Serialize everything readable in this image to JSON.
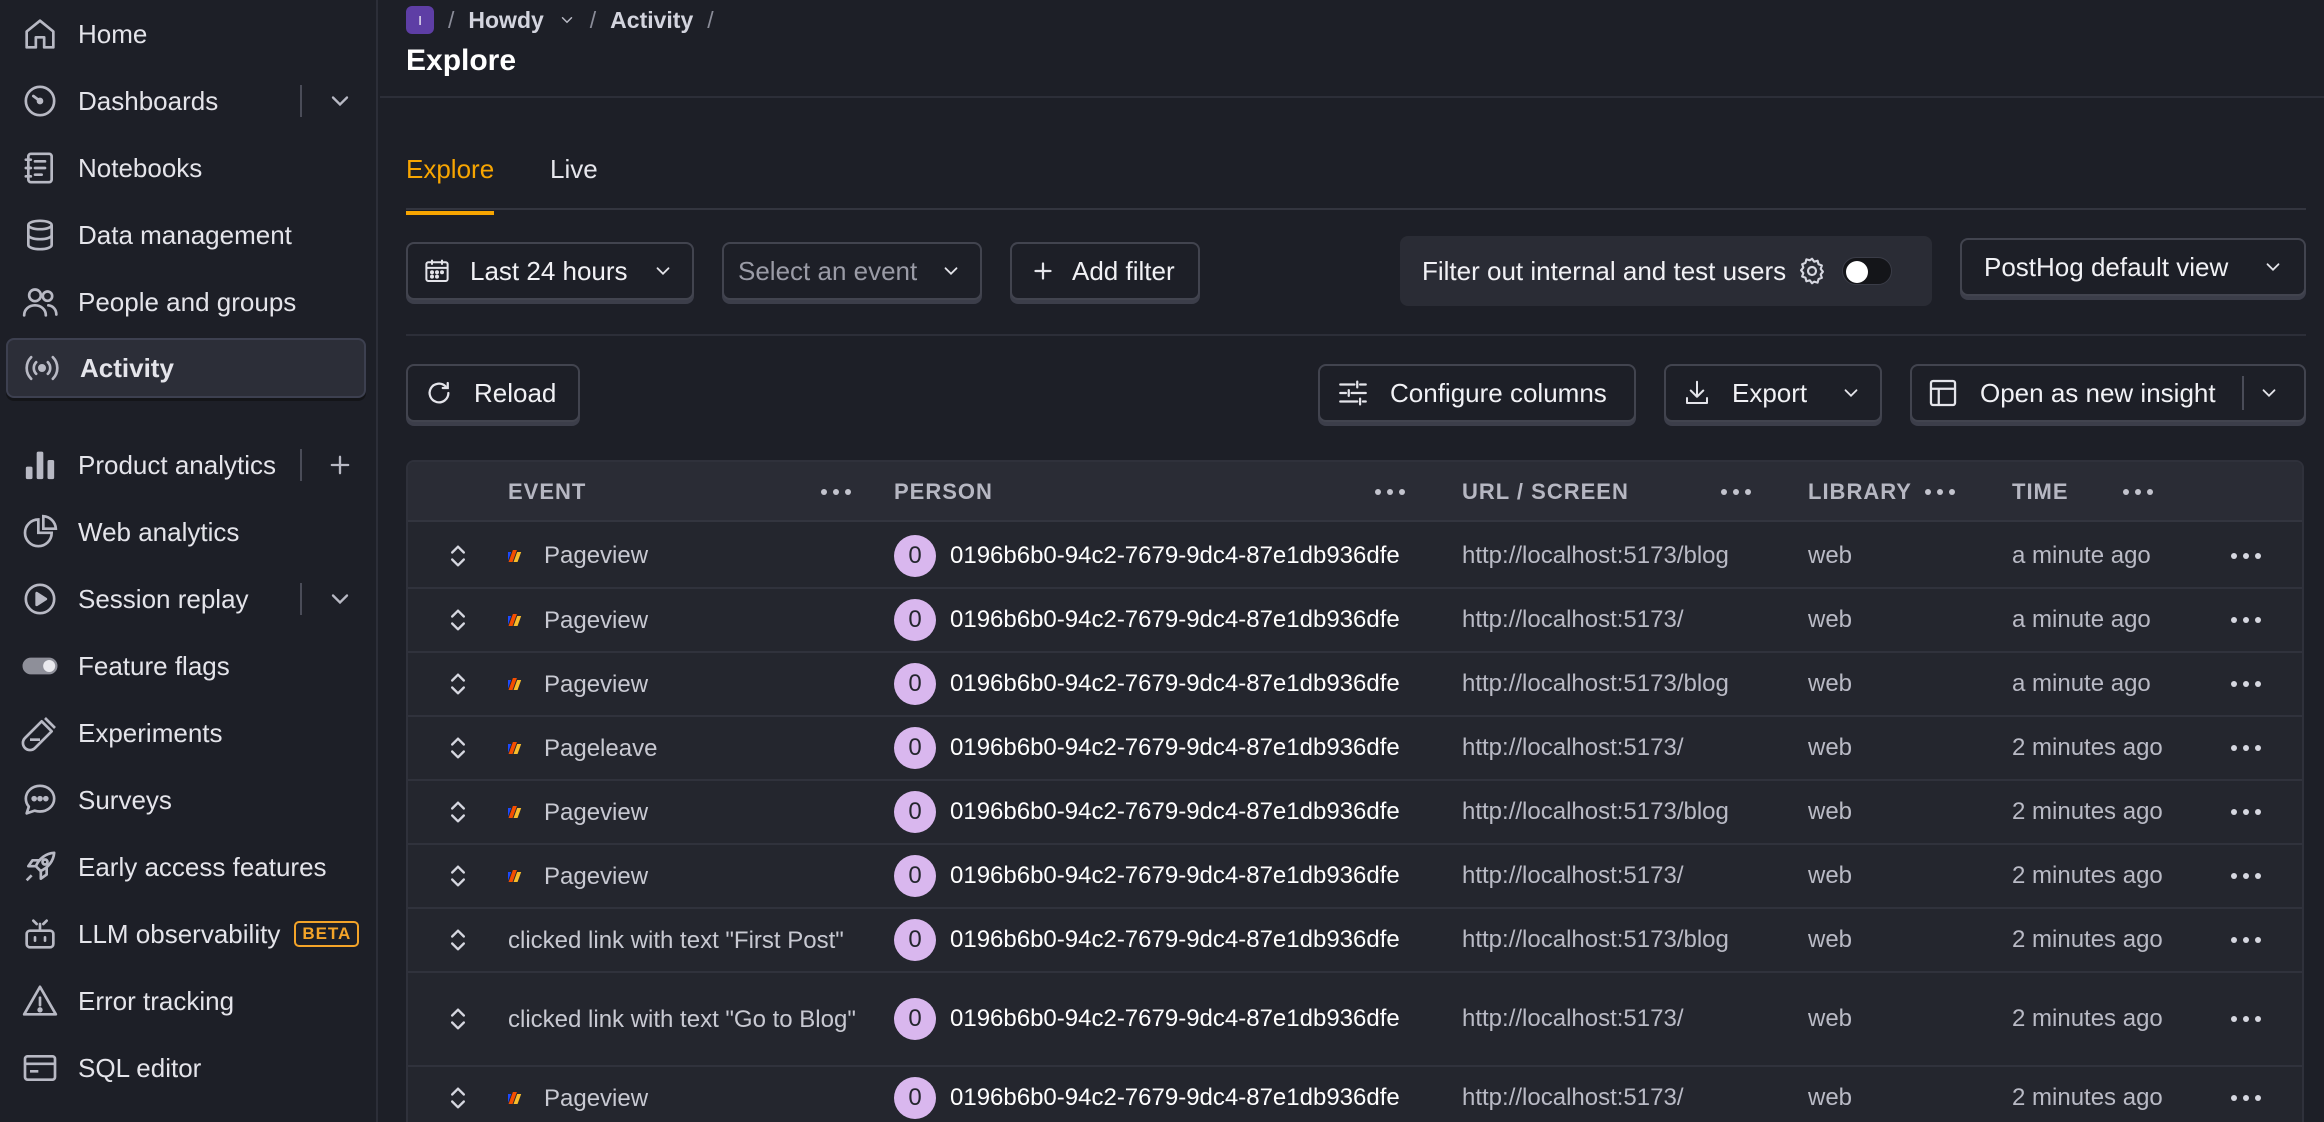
{
  "sidebar": {
    "items": [
      {
        "label": "Home",
        "icon": "home-icon"
      },
      {
        "label": "Dashboards",
        "icon": "dashboard-gauge-icon"
      },
      {
        "label": "Notebooks",
        "icon": "notebook-icon"
      },
      {
        "label": "Data management",
        "icon": "database-icon"
      },
      {
        "label": "People and groups",
        "icon": "people-icon"
      },
      {
        "label": "Activity",
        "icon": "broadcast-icon"
      },
      {
        "label": "Product analytics",
        "icon": "bar-chart-icon"
      },
      {
        "label": "Web analytics",
        "icon": "pie-chart-icon"
      },
      {
        "label": "Session replay",
        "icon": "replay-icon"
      },
      {
        "label": "Feature flags",
        "icon": "toggle-icon"
      },
      {
        "label": "Experiments",
        "icon": "flask-icon"
      },
      {
        "label": "Surveys",
        "icon": "chat-bubble-icon"
      },
      {
        "label": "Early access features",
        "icon": "rocket-icon"
      },
      {
        "label": "LLM observability",
        "icon": "llm-icon",
        "badge": "BETA"
      },
      {
        "label": "Error tracking",
        "icon": "warning-icon"
      },
      {
        "label": "SQL editor",
        "icon": "sql-editor-icon"
      }
    ]
  },
  "breadcrumb": {
    "project_badge": "I",
    "project": "Howdy",
    "section": "Activity"
  },
  "page": {
    "title": "Explore"
  },
  "tabs": [
    {
      "label": "Explore"
    },
    {
      "label": "Live"
    }
  ],
  "toolbar": {
    "date_range": "Last 24 hours",
    "event_placeholder": "Select an event",
    "add_filter": "Add filter",
    "filter_internal": "Filter out internal and test users",
    "view": "PostHog default view",
    "reload": "Reload",
    "configure_columns": "Configure columns",
    "export": "Export",
    "open_insight": "Open as new insight"
  },
  "colors": {
    "accent": "#f7a501",
    "avatar": "#d9b7ee",
    "background": "#1d1f27"
  },
  "table": {
    "columns": [
      "EVENT",
      "PERSON",
      "URL / SCREEN",
      "LIBRARY",
      "TIME"
    ],
    "rows": [
      {
        "event": "Pageview",
        "autocapture": false,
        "avatar": "0",
        "person": "0196b6b0-94c2-7679-9dc4-87e1db936dfe",
        "url": "http://localhost:5173/blog",
        "library": "web",
        "time": "a minute ago"
      },
      {
        "event": "Pageview",
        "autocapture": false,
        "avatar": "0",
        "person": "0196b6b0-94c2-7679-9dc4-87e1db936dfe",
        "url": "http://localhost:5173/",
        "library": "web",
        "time": "a minute ago"
      },
      {
        "event": "Pageview",
        "autocapture": false,
        "avatar": "0",
        "person": "0196b6b0-94c2-7679-9dc4-87e1db936dfe",
        "url": "http://localhost:5173/blog",
        "library": "web",
        "time": "a minute ago"
      },
      {
        "event": "Pageleave",
        "autocapture": false,
        "avatar": "0",
        "person": "0196b6b0-94c2-7679-9dc4-87e1db936dfe",
        "url": "http://localhost:5173/",
        "library": "web",
        "time": "2 minutes ago"
      },
      {
        "event": "Pageview",
        "autocapture": false,
        "avatar": "0",
        "person": "0196b6b0-94c2-7679-9dc4-87e1db936dfe",
        "url": "http://localhost:5173/blog",
        "library": "web",
        "time": "2 minutes ago"
      },
      {
        "event": "Pageview",
        "autocapture": false,
        "avatar": "0",
        "person": "0196b6b0-94c2-7679-9dc4-87e1db936dfe",
        "url": "http://localhost:5173/",
        "library": "web",
        "time": "2 minutes ago"
      },
      {
        "event": "clicked link with text \"First Post\"",
        "autocapture": true,
        "avatar": "0",
        "person": "0196b6b0-94c2-7679-9dc4-87e1db936dfe",
        "url": "http://localhost:5173/blog",
        "library": "web",
        "time": "2 minutes ago"
      },
      {
        "event": "clicked link with text \"Go to Blog\"",
        "autocapture": true,
        "avatar": "0",
        "person": "0196b6b0-94c2-7679-9dc4-87e1db936dfe",
        "url": "http://localhost:5173/",
        "library": "web",
        "time": "2 minutes ago"
      },
      {
        "event": "Pageview",
        "autocapture": false,
        "avatar": "0",
        "person": "0196b6b0-94c2-7679-9dc4-87e1db936dfe",
        "url": "http://localhost:5173/",
        "library": "web",
        "time": "2 minutes ago"
      }
    ]
  }
}
